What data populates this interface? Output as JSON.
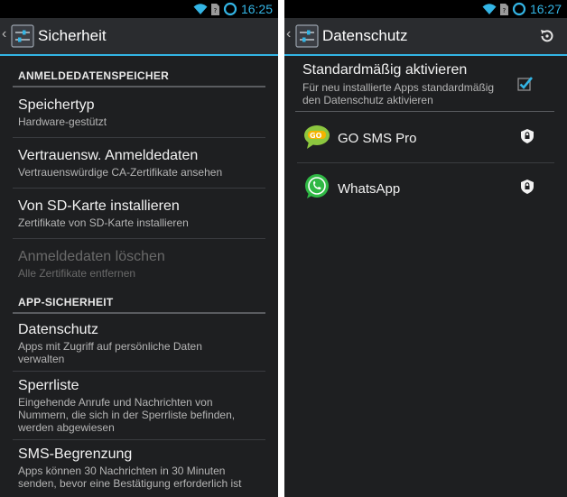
{
  "left": {
    "status": {
      "time": "16:25"
    },
    "actionbar": {
      "title": "Sicherheit"
    },
    "sections": [
      {
        "header": "ANMELDEDATENSPEICHER"
      },
      {
        "header": "APP-SICHERHEIT"
      }
    ],
    "items": [
      {
        "title": "Speichertyp",
        "sub1": "Hardware-gestützt"
      },
      {
        "title": "Vertrauensw. Anmeldedaten",
        "sub1": "Vertrauenswürdige CA-Zertifikate ansehen"
      },
      {
        "title": "Von SD-Karte installieren",
        "sub1": "Zertifikate von SD-Karte installieren"
      },
      {
        "title": "Anmeldedaten löschen",
        "sub1": "Alle Zertifikate entfernen"
      },
      {
        "title": "Datenschutz",
        "sub1": "Apps mit Zugriff auf persönliche Daten",
        "sub2": "verwalten"
      },
      {
        "title": "Sperrliste",
        "sub1": "Eingehende Anrufe und Nachrichten von",
        "sub2": "Nummern, die sich in der Sperrliste befinden,",
        "sub3": "werden abgewiesen"
      },
      {
        "title": "SMS-Begrenzung",
        "sub1": "Apps können 30 Nachrichten in 30 Minuten",
        "sub2": "senden, bevor eine Bestätigung erforderlich ist"
      }
    ]
  },
  "right": {
    "status": {
      "time": "16:27"
    },
    "actionbar": {
      "title": "Datenschutz"
    },
    "default_toggle": {
      "title": "Standardmäßig aktivieren",
      "sub1": "Für neu installierte Apps standardmäßig",
      "sub2": "den Datenschutz aktivieren",
      "checked": true
    },
    "apps": [
      {
        "name": "GO SMS Pro",
        "icon": "go-sms-pro-icon"
      },
      {
        "name": "WhatsApp",
        "icon": "whatsapp-icon"
      }
    ]
  },
  "colors": {
    "accent": "#33b5e5",
    "background": "#1e1f21",
    "go_sms": "#8cc63f",
    "whatsapp": "#2fb844"
  }
}
